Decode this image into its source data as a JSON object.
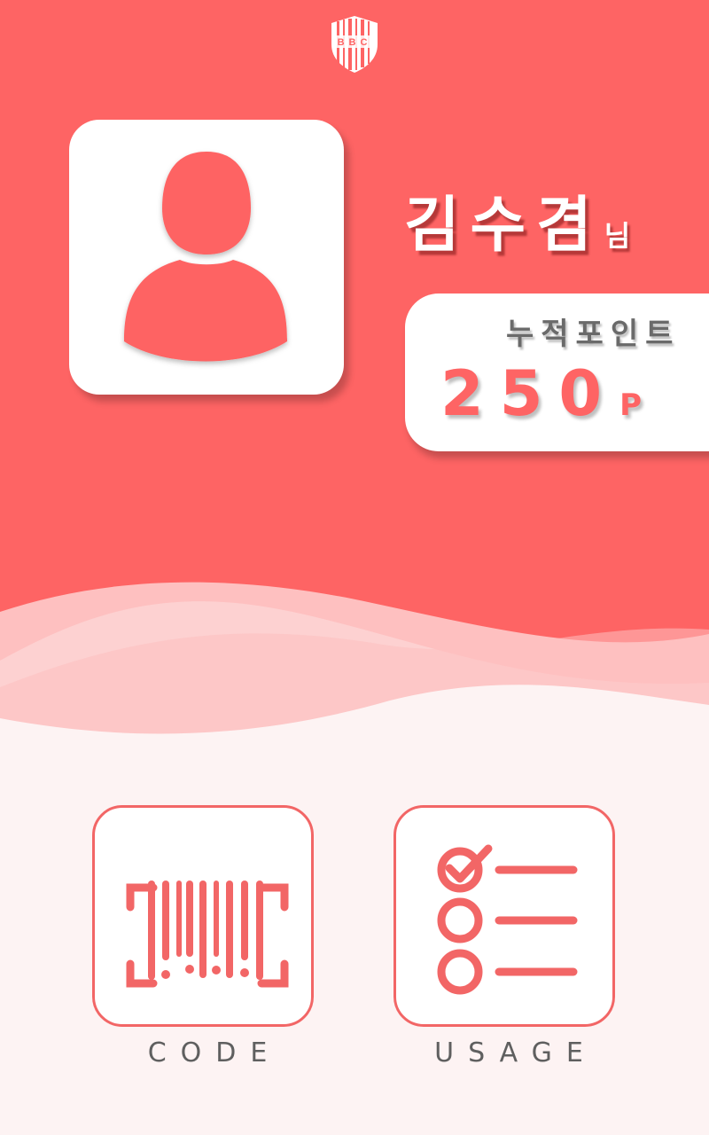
{
  "brand": {
    "logo_text": "BBC",
    "logo_icon": "shield-barcode-icon"
  },
  "profile": {
    "name": "김수겸",
    "honorific": "님",
    "avatar_icon": "user-silhouette-icon"
  },
  "points": {
    "label": "누적포인트",
    "value": "250",
    "unit": "P"
  },
  "actions": [
    {
      "label": "CODE",
      "icon": "barcode-scan-icon"
    },
    {
      "label": "USAGE",
      "icon": "checklist-icon"
    }
  ],
  "colors": {
    "accent": "#fe6464",
    "background": "#fdf3f3",
    "card": "#ffffff",
    "label_gray": "#6a6a6a"
  }
}
